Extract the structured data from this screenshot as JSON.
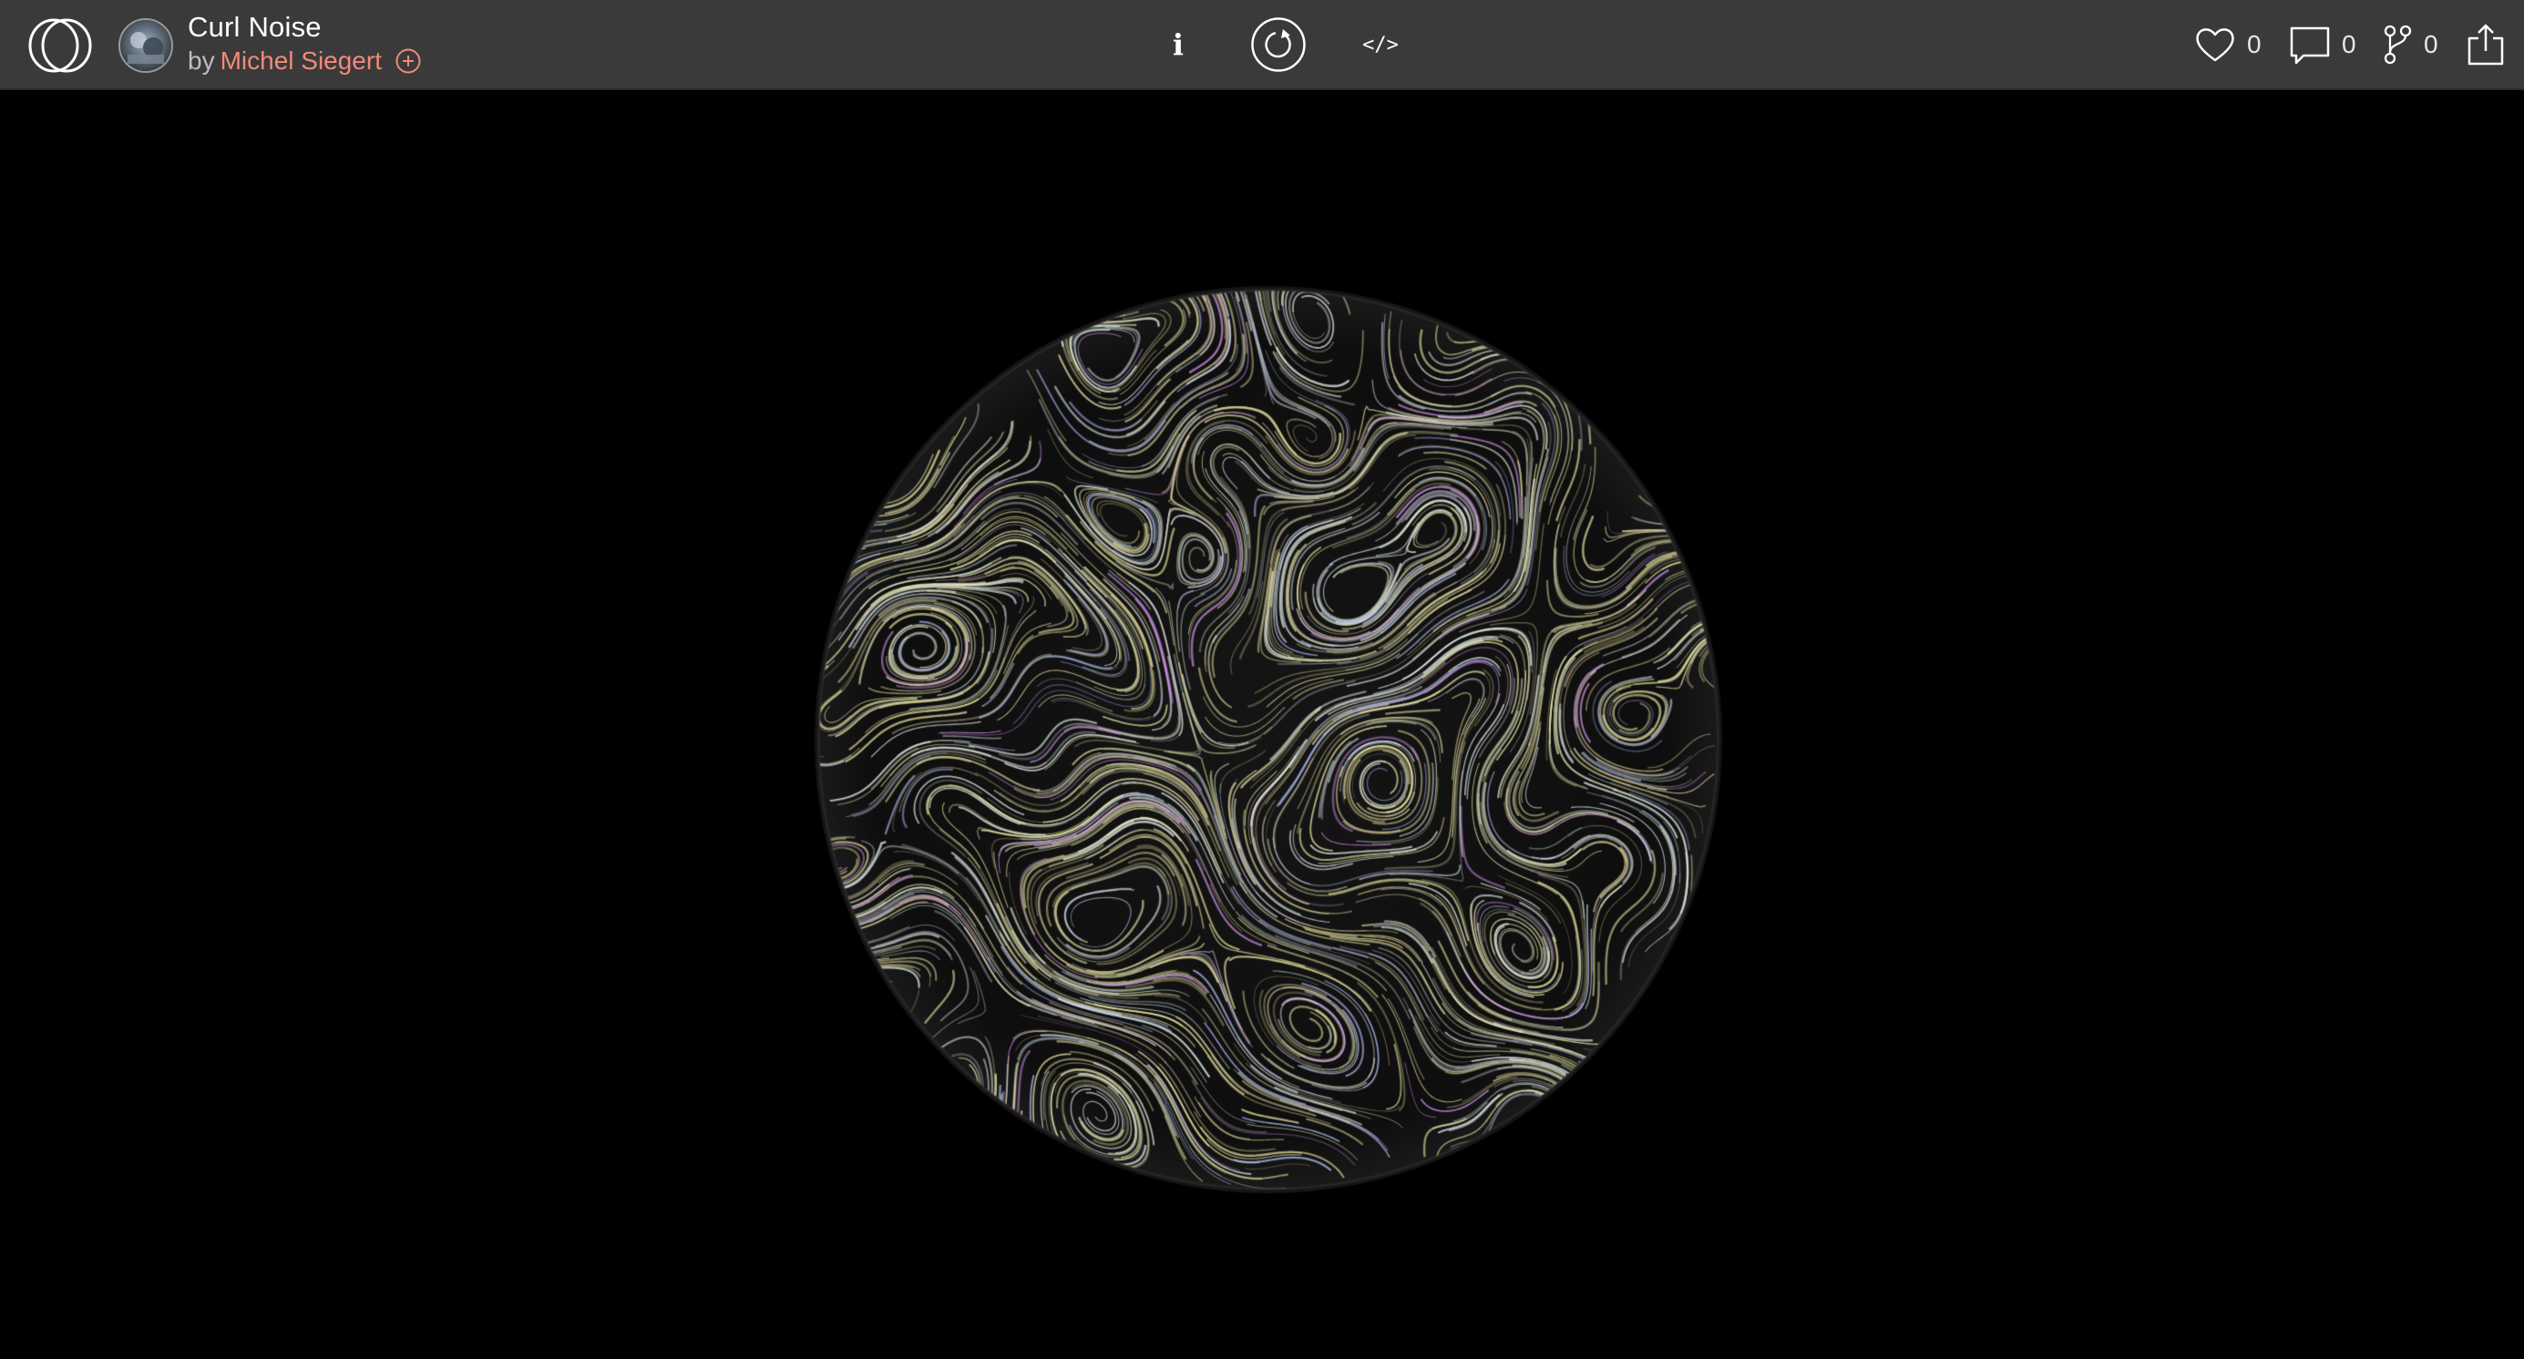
{
  "header": {
    "title": "Curl Noise",
    "by_prefix": "by",
    "author": "Michel Siegert"
  },
  "controls": {
    "info_label": "i",
    "code_label": "</>"
  },
  "stats": {
    "likes": "0",
    "comments": "0",
    "forks": "0"
  },
  "colors": {
    "topbar_bg": "#3a3a3a",
    "author_accent": "#f08a7a",
    "canvas_bg": "#000000",
    "stroke_yellow": "#e8e2a0",
    "stroke_pale": "#d9e6e4",
    "stroke_violet": "#c88ae0",
    "stroke_blue": "#a8b4e8"
  },
  "icons": {
    "logo": "openprocessing-logo-icon",
    "follow": "plus-circle-icon",
    "info": "info-icon",
    "restart": "restart-icon",
    "code": "code-icon",
    "like": "heart-icon",
    "comment": "comment-icon",
    "fork": "fork-icon",
    "share": "share-icon"
  }
}
